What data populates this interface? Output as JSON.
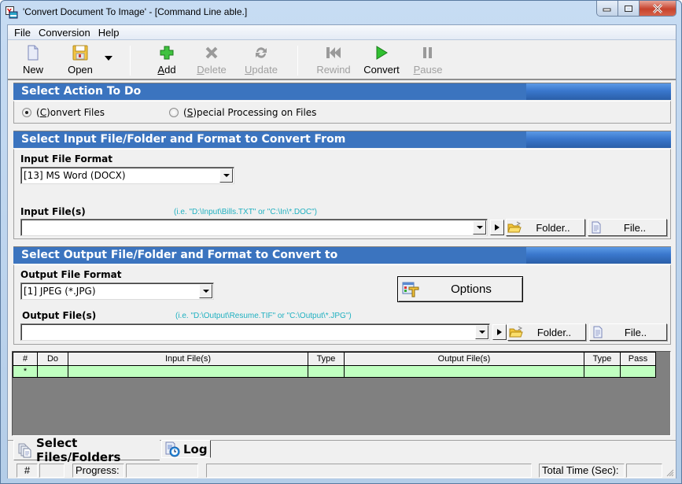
{
  "window": {
    "title": "'Convert Document To Image' - [Command Line able.]",
    "controls": {
      "minimize": "minimize",
      "maximize": "maximize",
      "close": "close"
    }
  },
  "menu": [
    "File",
    "Conversion",
    "Help"
  ],
  "toolbar": {
    "new": {
      "label": "New",
      "icon": "new-document-icon",
      "enabled": true
    },
    "open": {
      "label": "Open",
      "icon": "floppy-disk-icon",
      "enabled": true
    },
    "add": {
      "label_pre": "",
      "label_u": "A",
      "label_post": "dd",
      "icon": "plus-icon",
      "enabled": true
    },
    "delete": {
      "label_pre": "",
      "label_u": "D",
      "label_post": "elete",
      "icon": "x-icon",
      "enabled": false
    },
    "update": {
      "label_pre": "",
      "label_u": "U",
      "label_post": "pdate",
      "icon": "refresh-icon",
      "enabled": false
    },
    "rewind": {
      "label": "Rewind",
      "icon": "rewind-icon",
      "enabled": false
    },
    "convert": {
      "label": "Convert",
      "icon": "play-icon",
      "enabled": true
    },
    "pause": {
      "label_pre": "",
      "label_u": "P",
      "label_post": "ause",
      "icon": "pause-icon",
      "enabled": false
    }
  },
  "action_section": {
    "title": "Select Action To Do",
    "options": [
      {
        "pre": "(",
        "u": "C",
        "post": ")onvert Files",
        "selected": true
      },
      {
        "pre": "(",
        "u": "S",
        "post": ")pecial Processing on Files",
        "selected": false
      }
    ]
  },
  "input_section": {
    "title": "Select Input File/Folder and Format to Convert From",
    "format_label": "Input File Format",
    "format_value": "[13] MS Word (DOCX)",
    "files_label": "Input File(s)",
    "files_hint": "(i.e. \"D:\\Input\\Bills.TXT\"  or \"C:\\In\\*.DOC\")",
    "files_value": "",
    "folder_button": "Folder..",
    "file_button": "File.."
  },
  "output_section": {
    "title": "Select Output File/Folder and Format to Convert to",
    "format_label": "Output File Format",
    "format_value": "[1] JPEG (*.JPG)",
    "options_button": "Options",
    "files_label": "Output File(s)",
    "files_hint": "(i.e. \"D:\\Output\\Resume.TIF\" or \"C:\\Output\\*.JPG\")",
    "files_value": "",
    "folder_button": "Folder..",
    "file_button": "File.."
  },
  "grid": {
    "columns": [
      "#",
      "Do",
      "Input File(s)",
      "Type",
      "Output File(s)",
      "Type",
      "Pass"
    ],
    "rows": [
      [
        "*",
        "",
        "",
        "",
        "",
        "",
        ""
      ]
    ]
  },
  "tabs": [
    {
      "label": "Select Files/Folders",
      "active": true
    },
    {
      "label": "Log",
      "active": false
    }
  ],
  "statusbar": {
    "hash": "#",
    "count": "",
    "progress_label": "Progress:",
    "progress_value": "",
    "message": "",
    "total_time_label": "Total Time (Sec):",
    "total_time_value": ""
  }
}
